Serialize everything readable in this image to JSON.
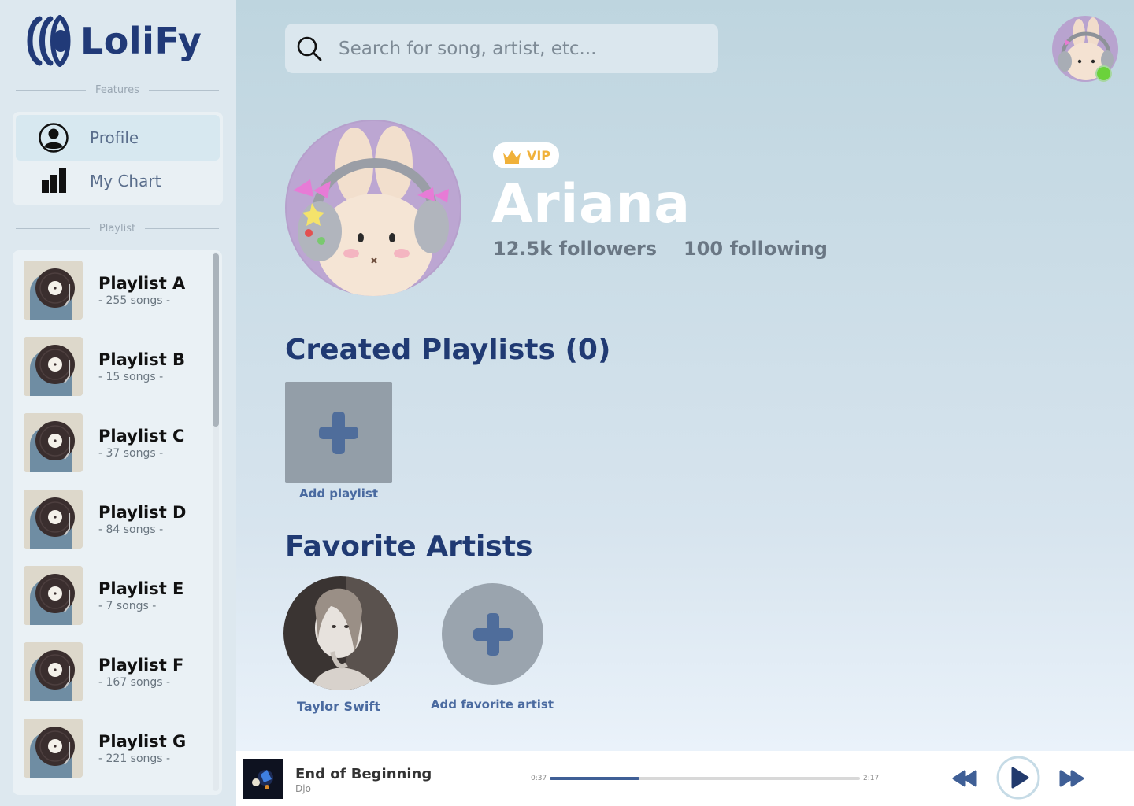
{
  "app": {
    "name": "LoliFy"
  },
  "sidebar": {
    "features_label": "Features",
    "features": [
      {
        "label": "Profile",
        "icon": "profile-icon",
        "active": true
      },
      {
        "label": "My Chart",
        "icon": "chart-icon",
        "active": false
      }
    ],
    "playlist_label": "Playlist",
    "playlists": [
      {
        "name": "Playlist A",
        "count": "- 255 songs -"
      },
      {
        "name": "Playlist B",
        "count": "- 15 songs -"
      },
      {
        "name": "Playlist C",
        "count": "- 37 songs -"
      },
      {
        "name": "Playlist D",
        "count": "- 84 songs -"
      },
      {
        "name": "Playlist E",
        "count": "- 7 songs -"
      },
      {
        "name": "Playlist F",
        "count": "- 167 songs -"
      },
      {
        "name": "Playlist G",
        "count": "- 221 songs -"
      }
    ]
  },
  "search": {
    "placeholder": "Search for song, artist, etc..."
  },
  "profile": {
    "badge": "VIP",
    "name": "Ariana",
    "followers": "12.5k followers",
    "following": "100 following"
  },
  "created_playlists": {
    "title": "Created Playlists (0)",
    "add_label": "Add playlist"
  },
  "favorite_artists": {
    "title": "Favorite Artists",
    "artists": [
      {
        "name": "Taylor Swift"
      }
    ],
    "add_label": "Add favorite artist"
  },
  "player": {
    "title": "End of Beginning",
    "artist": "Djo",
    "elapsed": "0:37",
    "duration": "2:17",
    "progress": 0.29
  },
  "colors": {
    "brand": "#213a78",
    "online": "#6bd23b",
    "vip": "#f0b13a",
    "accent": "#3f5f96"
  }
}
